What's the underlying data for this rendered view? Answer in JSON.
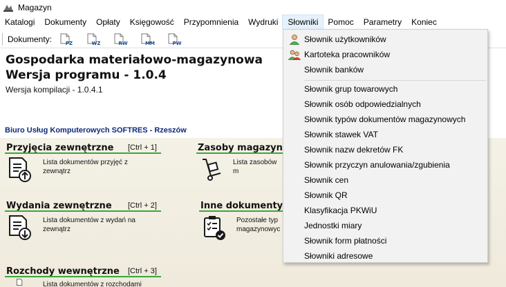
{
  "window": {
    "title": "Magazyn",
    "icon": "app-logo-icon"
  },
  "menubar": {
    "items": [
      {
        "label": "Katalogi"
      },
      {
        "label": "Dokumenty"
      },
      {
        "label": "Opłaty"
      },
      {
        "label": "Księgowość"
      },
      {
        "label": "Przypomnienia"
      },
      {
        "label": "Wydruki"
      },
      {
        "label": "Słowniki",
        "active": true
      },
      {
        "label": "Pomoc"
      },
      {
        "label": "Parametry"
      },
      {
        "label": "Koniec"
      }
    ]
  },
  "toolbar": {
    "label": "Dokumenty:",
    "buttons": [
      {
        "code": "PZ"
      },
      {
        "code": "WZ"
      },
      {
        "code": "RW"
      },
      {
        "code": "MM"
      },
      {
        "code": "PW"
      }
    ]
  },
  "header": {
    "title": "Gospodarka materiałowo-magazynowa",
    "version": "Wersja programu - 1.0.4",
    "build": "Wersja kompilacji - 1.0.4.1",
    "company": "Biuro Usług Komputerowych SOFTRES - Rzeszów"
  },
  "sections": [
    {
      "title": "Przyjęcia zewnętrzne",
      "shortcut": "[Ctrl + 1]",
      "desc1": "Lista dokumentów przyjęć z",
      "desc2": "zewnątrz",
      "icon": "document-arrow-up-icon"
    },
    {
      "title": "Wydania zewnętrzne",
      "shortcut": "[Ctrl + 2]",
      "desc1": "Lista dokumentów z wydań na",
      "desc2": "zewnątrz",
      "icon": "document-arrow-down-icon"
    },
    {
      "title": "Rozchody wewnętrzne",
      "shortcut": "[Ctrl + 3]",
      "desc1": "Lista dokumentów z rozchodami",
      "desc2": "",
      "icon": "document-icon"
    },
    {
      "title": "Zasoby magazynowe",
      "shortcut": "",
      "desc1": "Lista zasobów m",
      "desc2": "",
      "icon": "hand-truck-icon"
    },
    {
      "title": "Inne dokumenty m",
      "shortcut": "",
      "desc1": "Pozostałe typ",
      "desc2": "magazynowyc",
      "icon": "checklist-icon"
    }
  ],
  "dropdown": {
    "items": [
      {
        "label": "Słownik użytkowników",
        "icon": "user-icon"
      },
      {
        "label": "Kartoteka pracowników",
        "icon": "users-icon"
      },
      {
        "label": "Słownik banków"
      },
      {
        "separator": true
      },
      {
        "label": "Słownik grup towarowych"
      },
      {
        "label": "Słownik osób odpowiedzialnych"
      },
      {
        "label": "Słownik typów dokumentów magazynowych"
      },
      {
        "label": "Słownik stawek VAT"
      },
      {
        "label": "Słownik nazw dekretów FK"
      },
      {
        "label": "Słownik przyczyn anulowania/zgubienia"
      },
      {
        "label": "Słownik cen"
      },
      {
        "label": "Słownik QR"
      },
      {
        "label": "Klasyfikacja PKWiU"
      },
      {
        "label": "Jednostki miary"
      },
      {
        "label": "Słownik form płatności"
      },
      {
        "label": "Słowniki adresowe"
      }
    ]
  },
  "colors": {
    "accent_line": "#3aa63a",
    "company_text": "#0f2a7a",
    "menu_active_bg": "#e5f1fb"
  }
}
